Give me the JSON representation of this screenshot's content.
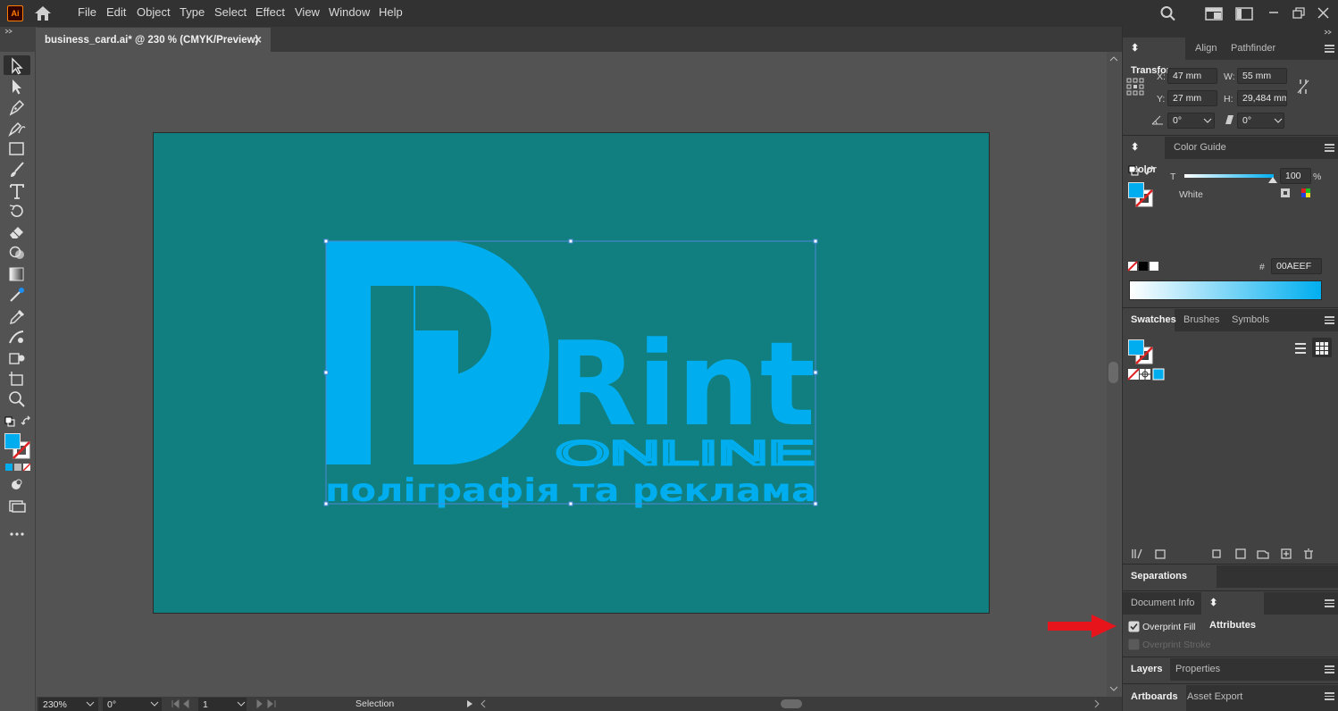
{
  "app": {
    "logo": "Ai",
    "menu": [
      "File",
      "Edit",
      "Object",
      "Type",
      "Select",
      "Effect",
      "View",
      "Window",
      "Help"
    ]
  },
  "document": {
    "tab_title": "business_card.ai* @ 230 % (CMYK/Preview)",
    "close_glyph": "×"
  },
  "artwork": {
    "word_main": "Rint",
    "word_sub": "ONLINE",
    "tagline": "поліграфія та реклама",
    "artboard_color": "#117f80",
    "art_color": "#00aeef"
  },
  "transform": {
    "tabs": [
      "Transform",
      "Align",
      "Pathfinder"
    ],
    "x_label": "X:",
    "x_value": "47 mm",
    "w_label": "W:",
    "w_value": "55 mm",
    "y_label": "Y:",
    "y_value": "27 mm",
    "h_label": "H:",
    "h_value": "29,484 mm",
    "angle_value": "0°",
    "shear_value": "0°"
  },
  "color": {
    "tabs": [
      "Color",
      "Color Guide"
    ],
    "channel_label": "T",
    "slider_value": "100",
    "percent": "%",
    "fill_name": "White",
    "hex_label": "#",
    "hex_value": "00AEEF",
    "fill_color": "#00aeef"
  },
  "swatches": {
    "tabs": [
      "Swatches",
      "Brushes",
      "Symbols"
    ]
  },
  "separations": {
    "title": "Separations Preview"
  },
  "attributes": {
    "tabs": [
      "Document Info",
      "Attributes"
    ],
    "overprint_fill_label": "Overprint Fill",
    "overprint_fill_checked": true,
    "overprint_stroke_label": "Overprint Stroke",
    "overprint_stroke_checked": false
  },
  "layers": {
    "tabs": [
      "Layers",
      "Properties"
    ]
  },
  "artboards": {
    "tabs": [
      "Artboards",
      "Asset Export"
    ]
  },
  "statusbar": {
    "zoom": "230%",
    "rotation": "0°",
    "artboard_number": "1",
    "tool": "Selection"
  }
}
